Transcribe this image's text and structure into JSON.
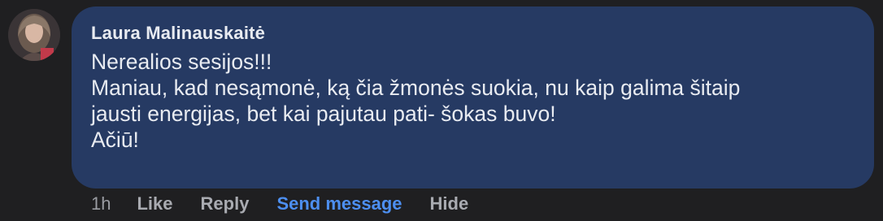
{
  "comment": {
    "author": "Laura Malinauskaitė",
    "lines": [
      "Nerealios sesijos!!!",
      "Maniau, kad nesąmonė, ką čia žmonės suokia, nu kaip galima šitaip",
      "jausti energijas, bet kai pajutau pati- šokas buvo!",
      "Ačiū!"
    ],
    "time": "1h",
    "actions": {
      "like": "Like",
      "reply": "Reply",
      "send_message": "Send message",
      "hide": "Hide"
    }
  },
  "colors": {
    "background": "#1f1f21",
    "bubble": "#263a63",
    "text": "#e8ebf1",
    "action_text": "#a9abb1",
    "accent": "#4d8ff0"
  }
}
